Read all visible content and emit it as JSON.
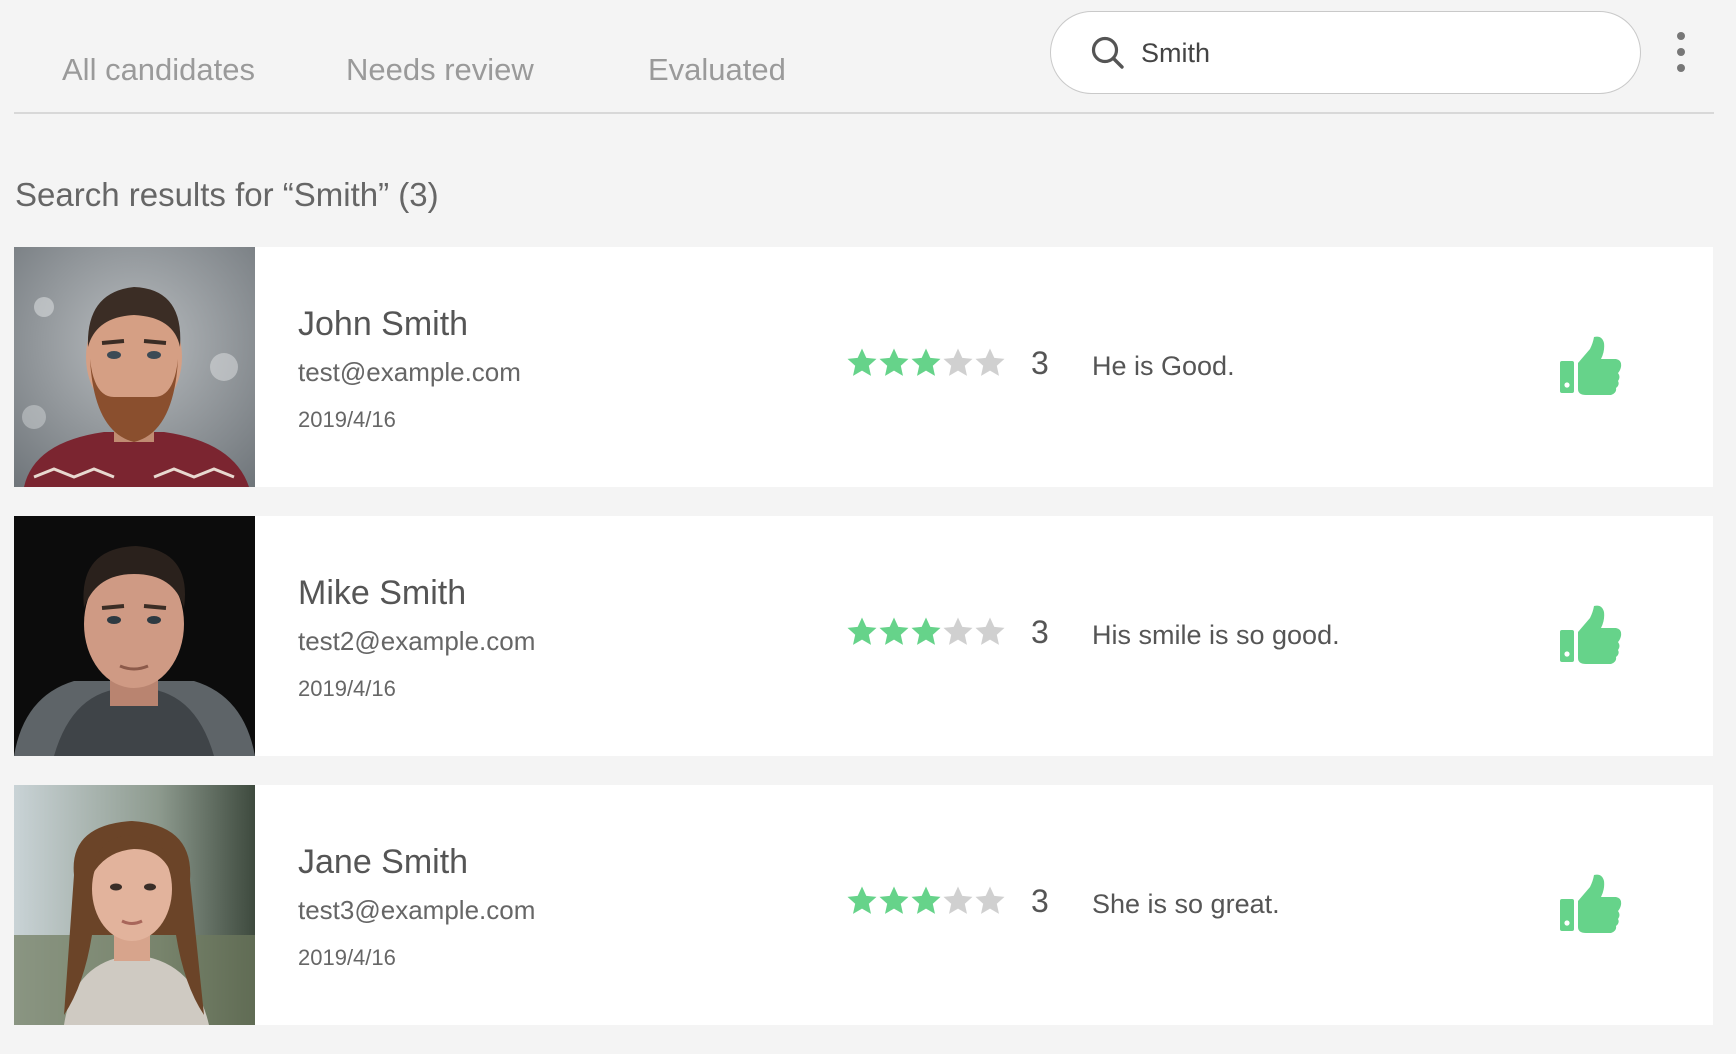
{
  "tabs": [
    {
      "label": "All candidates"
    },
    {
      "label": "Needs review"
    },
    {
      "label": "Evaluated"
    }
  ],
  "search": {
    "value": "Smith",
    "icon": "search-icon"
  },
  "menu": {
    "icon": "more-vertical-icon"
  },
  "results": {
    "title": "Search results for “Smith” (3)"
  },
  "colors": {
    "accent": "#66d38a",
    "star_empty": "#d0d0d0",
    "background": "#f4f4f4"
  },
  "candidates": [
    {
      "name": "John Smith",
      "email": "test@example.com",
      "date": "2019/4/16",
      "rating": 3,
      "rating_max": 5,
      "rating_label": "3",
      "comment": "He is Good.",
      "reaction": "thumbs-up-icon"
    },
    {
      "name": "Mike Smith",
      "email": "test2@example.com",
      "date": "2019/4/16",
      "rating": 3,
      "rating_max": 5,
      "rating_label": "3",
      "comment": "His smile is so good.",
      "reaction": "thumbs-up-icon"
    },
    {
      "name": "Jane Smith",
      "email": "test3@example.com",
      "date": "2019/4/16",
      "rating": 3,
      "rating_max": 5,
      "rating_label": "3",
      "comment": "She is so great.",
      "reaction": "thumbs-up-icon"
    }
  ]
}
